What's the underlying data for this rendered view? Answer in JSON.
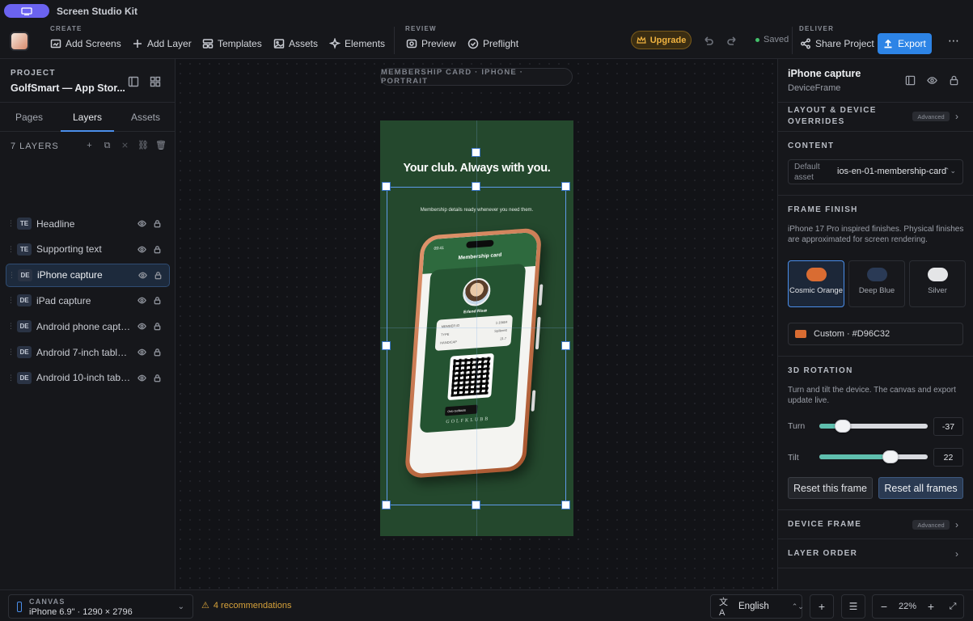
{
  "app": {
    "title": "Screen Studio Kit"
  },
  "toolbar": {
    "create_label": "CREATE",
    "review_label": "REVIEW",
    "deliver_label": "DELIVER",
    "add_screens": "Add Screens",
    "add_layer": "Add Layer",
    "templates": "Templates",
    "assets": "Assets",
    "elements": "Elements",
    "preview": "Preview",
    "preflight": "Preflight",
    "upgrade": "Upgrade",
    "saved": "Saved",
    "share_project": "Share Project",
    "export": "Export"
  },
  "project": {
    "label": "PROJECT",
    "name": "GolfSmart — App Stor..."
  },
  "left_tabs": [
    "Pages",
    "Layers",
    "Assets"
  ],
  "layers": {
    "count_label": "7 LAYERS",
    "items": [
      {
        "badge": "TE",
        "name": "Headline"
      },
      {
        "badge": "TE",
        "name": "Supporting text"
      },
      {
        "badge": "DE",
        "name": "iPhone capture",
        "selected": true
      },
      {
        "badge": "DE",
        "name": "iPad capture"
      },
      {
        "badge": "DE",
        "name": "Android phone capture"
      },
      {
        "badge": "DE",
        "name": "Android 7-inch tablet c..."
      },
      {
        "badge": "DE",
        "name": "Android 10-inch tablet ..."
      }
    ]
  },
  "canvas": {
    "chip": "MEMBERSHIP CARD · IPHONE · PORTRAIT",
    "headline": "Your club. Always with you.",
    "subtext": "Membership details ready whenever you need them.",
    "phone": {
      "time": "09:41",
      "screen_title": "Membership card",
      "member_name": "Erlend Risæ",
      "info_rows": [
        {
          "label": "MEMBER ID",
          "value": "1-15604"
        },
        {
          "label": "TYPE",
          "value": "Spillerett"
        },
        {
          "label": "HANDICAP",
          "value": "21.7"
        }
      ],
      "club_tag": "Oslo Golfklubb",
      "club_word": "GOLFKLUBB"
    }
  },
  "inspector": {
    "title": "iPhone capture",
    "subtitle": "DeviceFrame",
    "layout_section": "LAYOUT & DEVICE OVERRIDES",
    "advanced": "Advanced",
    "content_section": "CONTENT",
    "default_asset_label": "Default asset",
    "default_asset_value": "ios-en-01-membership-card",
    "frame_finish_section": "FRAME FINISH",
    "frame_finish_desc": "iPhone 17 Pro inspired finishes. Physical finishes are approximated for screen rendering.",
    "finishes": [
      {
        "label": "Cosmic Orange",
        "color": "#D96C32",
        "selected": true
      },
      {
        "label": "Deep Blue",
        "color": "#2A3A55"
      },
      {
        "label": "Silver",
        "color": "#E4E5E7"
      }
    ],
    "custom_label": "Custom · #D96C32",
    "custom_color": "#D96C32",
    "rotation_section": "3D ROTATION",
    "rotation_desc": "Turn and tilt the device. The canvas and export update live.",
    "turn_label": "Turn",
    "turn_value": "-37",
    "turn_fraction": 0.22,
    "tilt_label": "Tilt",
    "tilt_value": "22",
    "tilt_fraction": 0.66,
    "reset_frame": "Reset this frame",
    "reset_all": "Reset all frames",
    "device_frame_section": "DEVICE FRAME",
    "layer_order_section": "LAYER ORDER"
  },
  "bottom": {
    "canvas_label": "CANVAS",
    "canvas_value": "iPhone 6.9\" · 1290 × 2796",
    "recommendations": "4 recommendations",
    "language": "English",
    "zoom": "22%"
  },
  "colors": {
    "accent": "#2d84e6",
    "upgrade": "#f0b340",
    "frame_bg": "#24482d",
    "warning": "#d6a13a"
  }
}
